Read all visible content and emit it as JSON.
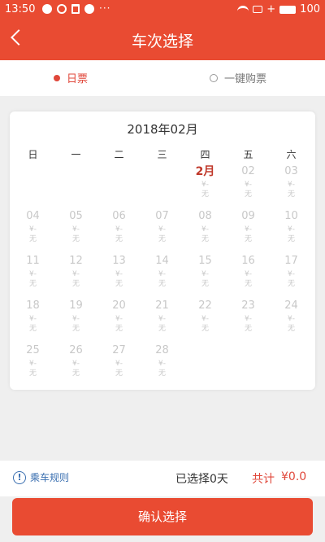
{
  "status_bar": {
    "time": "13:50",
    "battery": "100",
    "icons": [
      "message-icon",
      "alarm-icon",
      "trash-icon",
      "chat-icon",
      "more-dots-icon",
      "wifi-icon",
      "battery-saver-icon",
      "charging-icon",
      "battery-icon"
    ]
  },
  "nav": {
    "title": "车次选择",
    "back_icon": "chevron-left-icon"
  },
  "tabs": {
    "daily": "日票",
    "one_click": "一键购票",
    "selected": "daily"
  },
  "calendar": {
    "title": "2018年02月",
    "weekdays": [
      "日",
      "一",
      "二",
      "三",
      "四",
      "五",
      "六"
    ],
    "days": [
      {
        "num": "2月",
        "price": "¥-",
        "count": "无",
        "month_label": true
      },
      {
        "num": "02",
        "price": "¥-",
        "count": "无"
      },
      {
        "num": "03",
        "price": "¥-",
        "count": "无"
      },
      {
        "num": "04",
        "price": "¥-",
        "count": "无"
      },
      {
        "num": "05",
        "price": "¥-",
        "count": "无"
      },
      {
        "num": "06",
        "price": "¥-",
        "count": "无"
      },
      {
        "num": "07",
        "price": "¥-",
        "count": "无"
      },
      {
        "num": "08",
        "price": "¥-",
        "count": "无"
      },
      {
        "num": "09",
        "price": "¥-",
        "count": "无"
      },
      {
        "num": "10",
        "price": "¥-",
        "count": "无"
      },
      {
        "num": "11",
        "price": "¥-",
        "count": "无"
      },
      {
        "num": "12",
        "price": "¥-",
        "count": "无"
      },
      {
        "num": "13",
        "price": "¥-",
        "count": "无"
      },
      {
        "num": "14",
        "price": "¥-",
        "count": "无"
      },
      {
        "num": "15",
        "price": "¥-",
        "count": "无"
      },
      {
        "num": "16",
        "price": "¥-",
        "count": "无"
      },
      {
        "num": "17",
        "price": "¥-",
        "count": "无"
      },
      {
        "num": "18",
        "price": "¥-",
        "count": "无"
      },
      {
        "num": "19",
        "price": "¥-",
        "count": "无"
      },
      {
        "num": "20",
        "price": "¥-",
        "count": "无"
      },
      {
        "num": "21",
        "price": "¥-",
        "count": "无"
      },
      {
        "num": "22",
        "price": "¥-",
        "count": "无"
      },
      {
        "num": "23",
        "price": "¥-",
        "count": "无"
      },
      {
        "num": "24",
        "price": "¥-",
        "count": "无"
      },
      {
        "num": "25",
        "price": "¥-",
        "count": "无"
      },
      {
        "num": "26",
        "price": "¥-",
        "count": "无"
      },
      {
        "num": "27",
        "price": "¥-",
        "count": "无"
      },
      {
        "num": "28",
        "price": "¥-",
        "count": "无"
      }
    ]
  },
  "summary": {
    "rules_label": "乘车规则",
    "selected_text": "已选择0天",
    "total_label": "共计",
    "total_value": "¥0.0"
  },
  "confirm_label": "确认选择",
  "colors": {
    "primary": "#e94b32",
    "accent_text": "#e0473a",
    "link": "#3a6fb0",
    "disabled": "#c8c8c8"
  }
}
